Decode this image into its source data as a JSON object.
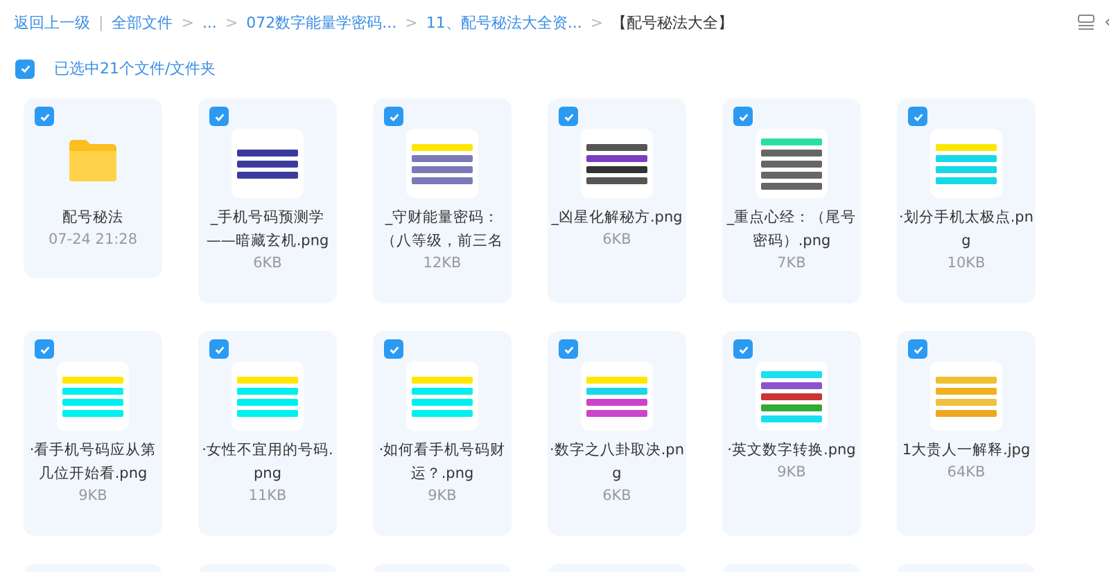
{
  "breadcrumb": {
    "back": "返回上一级",
    "separator": "|",
    "items": [
      {
        "label": "全部文件"
      },
      {
        "label": "..."
      },
      {
        "label": "072数字能量学密码..."
      },
      {
        "label": "11、配号秘法大全资..."
      },
      {
        "label": "【配号秘法大全】",
        "current": true
      }
    ],
    "arrow": ">"
  },
  "selection": {
    "selected": true,
    "label": "已选中21个文件/文件夹"
  },
  "files": [
    {
      "kind": "folder",
      "name": "配号秘法",
      "meta": "07-24 21:28",
      "selected": true
    },
    {
      "kind": "image",
      "name": "_手机号码预测学——暗藏玄机.png",
      "meta": "6KB",
      "selected": true
    },
    {
      "kind": "image",
      "name": "_守财能量密码：（八等级，前三名",
      "meta": "12KB",
      "selected": true
    },
    {
      "kind": "image",
      "name": "_凶星化解秘方.png",
      "meta": "6KB",
      "selected": true
    },
    {
      "kind": "image",
      "name": "_重点心经：（尾号密码）.png",
      "meta": "7KB",
      "selected": true
    },
    {
      "kind": "image",
      "name": "·划分手机太极点.png",
      "meta": "10KB",
      "selected": true
    },
    {
      "kind": "image",
      "name": "·看手机号码应从第几位开始看.png",
      "meta": "9KB",
      "selected": true
    },
    {
      "kind": "image",
      "name": "·女性不宜用的号码.png",
      "meta": "11KB",
      "selected": true
    },
    {
      "kind": "image",
      "name": "·如何看手机号码财运？.png",
      "meta": "9KB",
      "selected": true
    },
    {
      "kind": "image",
      "name": "·数字之八卦取决.png",
      "meta": "6KB",
      "selected": true
    },
    {
      "kind": "image",
      "name": "·英文数字转换.png",
      "meta": "9KB",
      "selected": true
    },
    {
      "kind": "image",
      "name": "1大贵人一解释.jpg",
      "meta": "64KB",
      "selected": true
    },
    {
      "kind": "partial"
    },
    {
      "kind": "partial"
    },
    {
      "kind": "partial"
    },
    {
      "kind": "partial"
    },
    {
      "kind": "partial"
    },
    {
      "kind": "partial"
    }
  ]
}
